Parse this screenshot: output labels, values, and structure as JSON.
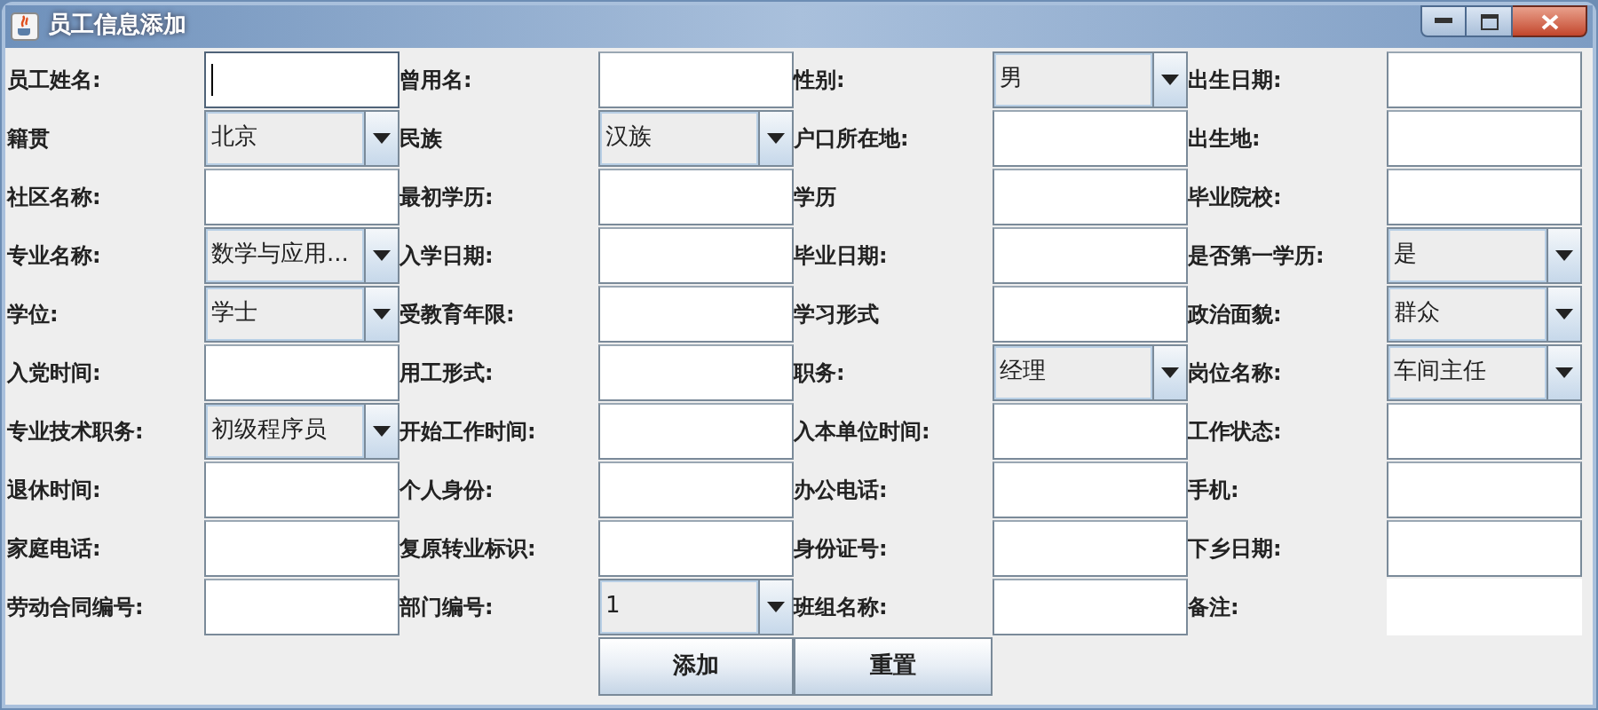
{
  "window": {
    "title": "员工信息添加"
  },
  "form": {
    "rows": [
      [
        {
          "label": "员工姓名:",
          "field": {
            "kind": "text",
            "focused": true
          }
        },
        {
          "label": "曾用名:",
          "field": {
            "kind": "text",
            "focused": false
          }
        },
        {
          "label": "性别:",
          "field": {
            "kind": "combo",
            "value": "男"
          }
        },
        {
          "label": "出生日期:",
          "field": {
            "kind": "text",
            "focused": false
          }
        }
      ],
      [
        {
          "label": "籍贯",
          "field": {
            "kind": "combo",
            "value": "北京"
          }
        },
        {
          "label": "民族",
          "field": {
            "kind": "combo",
            "value": "汉族"
          }
        },
        {
          "label": "户口所在地:",
          "field": {
            "kind": "text",
            "focused": false
          }
        },
        {
          "label": "出生地:",
          "field": {
            "kind": "text",
            "focused": false
          }
        }
      ],
      [
        {
          "label": "社区名称:",
          "field": {
            "kind": "text",
            "focused": false
          }
        },
        {
          "label": "最初学历:",
          "field": {
            "kind": "text",
            "focused": false
          }
        },
        {
          "label": "学历",
          "field": {
            "kind": "text",
            "focused": false
          }
        },
        {
          "label": "毕业院校:",
          "field": {
            "kind": "text",
            "focused": false
          }
        }
      ],
      [
        {
          "label": "专业名称:",
          "field": {
            "kind": "combo",
            "value": "数学与应用..."
          }
        },
        {
          "label": "入学日期:",
          "field": {
            "kind": "text",
            "focused": false
          }
        },
        {
          "label": "毕业日期:",
          "field": {
            "kind": "text",
            "focused": false
          }
        },
        {
          "label": "是否第一学历:",
          "field": {
            "kind": "combo",
            "value": "是"
          }
        }
      ],
      [
        {
          "label": "学位:",
          "field": {
            "kind": "combo",
            "value": "学士"
          }
        },
        {
          "label": "受教育年限:",
          "field": {
            "kind": "text",
            "focused": false
          }
        },
        {
          "label": "学习形式",
          "field": {
            "kind": "text",
            "focused": false
          }
        },
        {
          "label": "政治面貌:",
          "field": {
            "kind": "combo",
            "value": "群众"
          }
        }
      ],
      [
        {
          "label": "入党时间:",
          "field": {
            "kind": "text",
            "focused": false
          }
        },
        {
          "label": "用工形式:",
          "field": {
            "kind": "text",
            "focused": false
          }
        },
        {
          "label": "职务:",
          "field": {
            "kind": "combo",
            "value": "经理"
          }
        },
        {
          "label": "岗位名称:",
          "field": {
            "kind": "combo",
            "value": "车间主任"
          }
        }
      ],
      [
        {
          "label": "专业技术职务:",
          "field": {
            "kind": "combo",
            "value": "初级程序员"
          }
        },
        {
          "label": "开始工作时间:",
          "field": {
            "kind": "text",
            "focused": false
          }
        },
        {
          "label": "入本单位时间:",
          "field": {
            "kind": "text",
            "focused": false
          }
        },
        {
          "label": "工作状态:",
          "field": {
            "kind": "text",
            "focused": false
          }
        }
      ],
      [
        {
          "label": "退休时间:",
          "field": {
            "kind": "text",
            "focused": false
          }
        },
        {
          "label": "个人身份:",
          "field": {
            "kind": "text",
            "focused": false
          }
        },
        {
          "label": "办公电话:",
          "field": {
            "kind": "text",
            "focused": false
          }
        },
        {
          "label": "手机:",
          "field": {
            "kind": "text",
            "focused": false
          }
        }
      ],
      [
        {
          "label": "家庭电话:",
          "field": {
            "kind": "text",
            "focused": false
          }
        },
        {
          "label": "复原转业标识:",
          "field": {
            "kind": "text",
            "focused": false
          }
        },
        {
          "label": "身份证号:",
          "field": {
            "kind": "text",
            "focused": false
          }
        },
        {
          "label": "下乡日期:",
          "field": {
            "kind": "text",
            "focused": false
          }
        }
      ],
      [
        {
          "label": "劳动合同编号:",
          "field": {
            "kind": "text",
            "focused": false
          }
        },
        {
          "label": "部门编号:",
          "field": {
            "kind": "combo",
            "value": "1"
          }
        },
        {
          "label": "班组名称:",
          "field": {
            "kind": "text",
            "focused": false
          }
        },
        {
          "label": "备注:",
          "field": {
            "kind": "area"
          }
        }
      ]
    ]
  },
  "buttons": [
    "添加",
    "重置"
  ]
}
